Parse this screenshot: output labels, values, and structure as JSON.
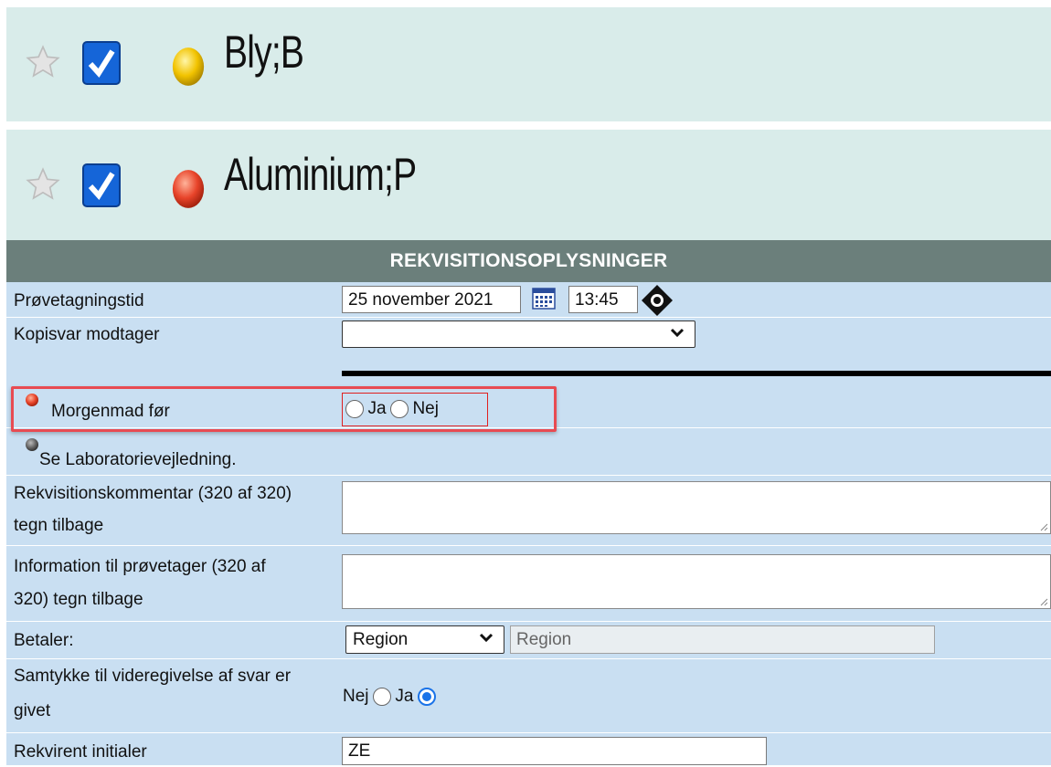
{
  "tests": [
    {
      "name": "Bly;B",
      "dot_color": "#f2c300"
    },
    {
      "name": "Aluminium;P",
      "dot_color": "#e8442a"
    }
  ],
  "form": {
    "header": "REKVISITIONSOPLYSNINGER",
    "sampling_time": {
      "label": "Prøvetagningstid",
      "date": "25 november 2021",
      "time": "13:45"
    },
    "copy_recipient": {
      "label": "Kopisvar modtager",
      "value": ""
    },
    "breakfast": {
      "label": "Morgenmad før",
      "option_yes": "Ja",
      "option_no": "Nej"
    },
    "lab_guide": {
      "text": "Se Laboratorievejledning."
    },
    "requisition_comment": {
      "label_line1": "Rekvisitionskommentar (320 af 320)",
      "label_line2": "tegn tilbage",
      "value": ""
    },
    "sampler_info": {
      "label_line1": "Information til prøvetager (320 af",
      "label_line2": "320) tegn tilbage",
      "value": ""
    },
    "payer": {
      "label": "Betaler:",
      "selected": "Region",
      "readonly_value": "Region"
    },
    "consent": {
      "label_line1": "Samtykke til videregivelse af svar er",
      "label_line2": "givet",
      "option_no": "Nej",
      "option_yes": "Ja",
      "selected": "Ja"
    },
    "initials": {
      "label": "Rekvirent initialer",
      "value": "ZE"
    }
  }
}
